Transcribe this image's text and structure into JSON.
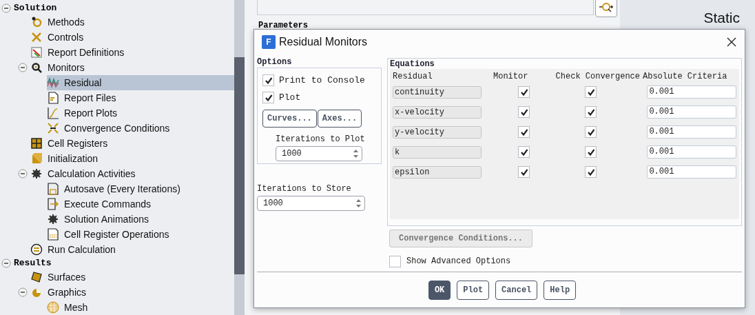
{
  "tree": [
    {
      "label": "Solution",
      "kind": "section",
      "expanded": true,
      "selected": false,
      "children": [
        {
          "label": "Methods",
          "kind": "item",
          "selected": false
        },
        {
          "label": "Controls",
          "kind": "item",
          "selected": false
        },
        {
          "label": "Report Definitions",
          "kind": "item",
          "selected": false
        },
        {
          "label": "Monitors",
          "kind": "item",
          "expanded": true,
          "selected": false,
          "children": [
            {
              "label": "Residual",
              "kind": "item",
              "selected": true
            },
            {
              "label": "Report Files",
              "kind": "item",
              "selected": false
            },
            {
              "label": "Report Plots",
              "kind": "item",
              "selected": false
            },
            {
              "label": "Convergence Conditions",
              "kind": "item",
              "selected": false
            }
          ]
        },
        {
          "label": "Cell Registers",
          "kind": "item",
          "selected": false
        },
        {
          "label": "Initialization",
          "kind": "item",
          "selected": false
        },
        {
          "label": "Calculation Activities",
          "kind": "item",
          "expanded": true,
          "selected": false,
          "children": [
            {
              "label": "Autosave (Every Iterations)",
              "kind": "item",
              "selected": false
            },
            {
              "label": "Execute Commands",
              "kind": "item",
              "selected": false
            },
            {
              "label": "Solution Animations",
              "kind": "item",
              "selected": false
            },
            {
              "label": "Cell Register Operations",
              "kind": "item",
              "selected": false
            }
          ]
        },
        {
          "label": "Run Calculation",
          "kind": "item",
          "selected": false
        }
      ]
    },
    {
      "label": "Results",
      "kind": "section",
      "expanded": true,
      "selected": false,
      "children": [
        {
          "label": "Surfaces",
          "kind": "item",
          "selected": false
        },
        {
          "label": "Graphics",
          "kind": "item",
          "expanded": true,
          "selected": false,
          "children": [
            {
              "label": "Mesh",
              "kind": "item",
              "selected": false
            }
          ]
        }
      ]
    }
  ],
  "background": {
    "section_label": "Parameters",
    "plot_title": "Static"
  },
  "dialog": {
    "app_badge": "F",
    "title": "Residual Monitors",
    "options": {
      "title": "Options",
      "checkboxes": [
        {
          "label": "Print to Console",
          "checked": true
        },
        {
          "label": "Plot",
          "checked": true
        }
      ],
      "buttons": [
        "Curves...",
        "Axes..."
      ],
      "iterations_to_plot": {
        "label": "Iterations to Plot",
        "value": "1000"
      }
    },
    "iterations_to_store": {
      "label": "Iterations to Store",
      "value": "1000"
    },
    "equations": {
      "title": "Equations",
      "columns": [
        "Residual",
        "Monitor",
        "Check Convergence",
        "Absolute Criteria"
      ],
      "rows": [
        {
          "residual": "continuity",
          "monitor": true,
          "check_convergence": true,
          "criteria": "0.001"
        },
        {
          "residual": "x-velocity",
          "monitor": true,
          "check_convergence": true,
          "criteria": "0.001"
        },
        {
          "residual": "y-velocity",
          "monitor": true,
          "check_convergence": true,
          "criteria": "0.001"
        },
        {
          "residual": "k",
          "monitor": true,
          "check_convergence": true,
          "criteria": "0.001"
        },
        {
          "residual": "epsilon",
          "monitor": true,
          "check_convergence": true,
          "criteria": "0.001"
        }
      ]
    },
    "convergence_button": {
      "label": "Convergence Conditions...",
      "disabled": true
    },
    "advanced": {
      "label": "Show Advanced Options",
      "checked": false
    },
    "buttons": [
      {
        "label": "OK",
        "primary": true
      },
      {
        "label": "Plot",
        "primary": false
      },
      {
        "label": "Cancel",
        "primary": false
      },
      {
        "label": "Help",
        "primary": false
      }
    ]
  }
}
